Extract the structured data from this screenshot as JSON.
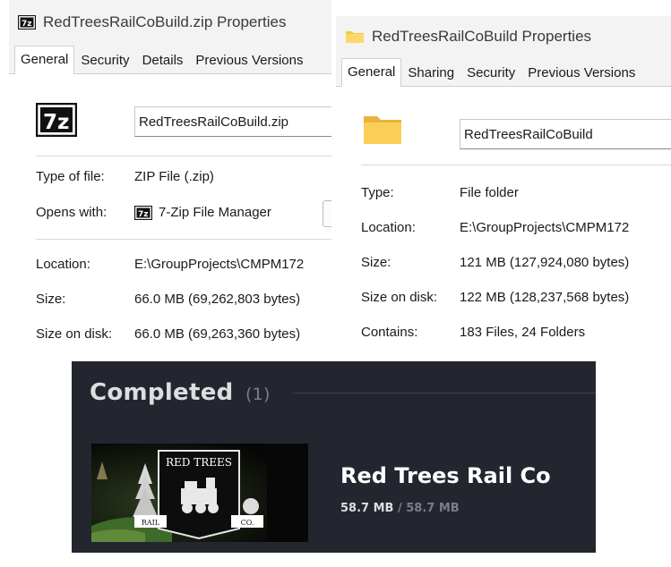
{
  "zip_window": {
    "title": "RedTreesRailCoBuild.zip Properties",
    "tabs": [
      "General",
      "Security",
      "Details",
      "Previous Versions"
    ],
    "file_name": "RedTreesRailCoBuild.zip",
    "rows": [
      {
        "label": "Type of file:",
        "value": "ZIP File (.zip)"
      },
      {
        "label": "Opens with:",
        "value": "7-Zip File Manager",
        "icon": "7zip-icon"
      },
      {
        "label": "Location:",
        "value": "E:\\GroupProjects\\CMPM172"
      },
      {
        "label": "Size:",
        "value": "66.0 MB (69,262,803 bytes)"
      },
      {
        "label": "Size on disk:",
        "value": "66.0 MB (69,263,360 bytes)"
      }
    ]
  },
  "folder_window": {
    "title": "RedTreesRailCoBuild Properties",
    "tabs": [
      "General",
      "Sharing",
      "Security",
      "Previous Versions"
    ],
    "folder_name": "RedTreesRailCoBuild",
    "rows": [
      {
        "label": "Type:",
        "value": "File folder"
      },
      {
        "label": "Location:",
        "value": "E:\\GroupProjects\\CMPM172"
      },
      {
        "label": "Size:",
        "value": "121 MB (127,924,080 bytes)"
      },
      {
        "label": "Size on disk:",
        "value": "122 MB (128,237,568 bytes)"
      },
      {
        "label": "Contains:",
        "value": "183 Files, 24 Folders"
      }
    ]
  },
  "steam_downloads": {
    "heading": "Completed",
    "count": "(1)",
    "game": {
      "name": "Red Trees Rail Co",
      "downloaded": "58.7 MB",
      "separator": "/",
      "total": "58.7 MB",
      "logo_text": {
        "top": "RED TREES",
        "left": "RAIL",
        "right": "CO."
      }
    }
  },
  "colors": {
    "window_bg": "#f3f3f3",
    "panel_bg": "#ffffff",
    "folder_yellow": "#f8c94a",
    "steam_bg": "#23262e",
    "steam_text": "#dcdedf",
    "steam_muted": "#7a7e86"
  }
}
